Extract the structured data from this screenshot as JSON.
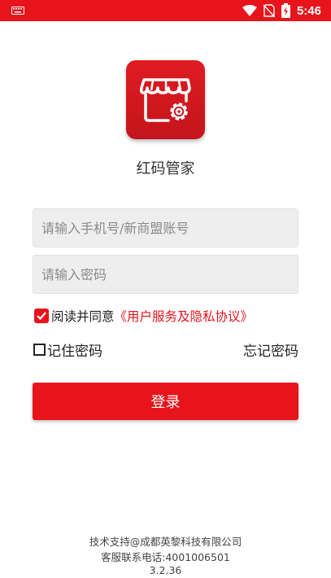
{
  "status_bar": {
    "time": "5:46",
    "icons": [
      "keyboard-icon",
      "wifi-icon",
      "no-sim-icon",
      "battery-charging-icon"
    ],
    "color": "#e8141c"
  },
  "app": {
    "name": "红码管家",
    "logo_icon": "store-gear-icon"
  },
  "form": {
    "account_placeholder": "请输入手机号/新商盟账号",
    "password_placeholder": "请输入密码",
    "agree_prefix": "阅读并同意",
    "agree_link": "《用户服务及隐私协议》",
    "agree_checked": true,
    "remember_label": "记住密码",
    "remember_checked": false,
    "forgot_label": "忘记密码",
    "login_label": "登录"
  },
  "footer": {
    "support": "技术支持@成都英黎科技有限公司",
    "hotline": "客服联系电话:4001006501",
    "version": "3.2.36"
  },
  "colors": {
    "accent": "#e8141c",
    "input_bg": "#eeeeee"
  }
}
